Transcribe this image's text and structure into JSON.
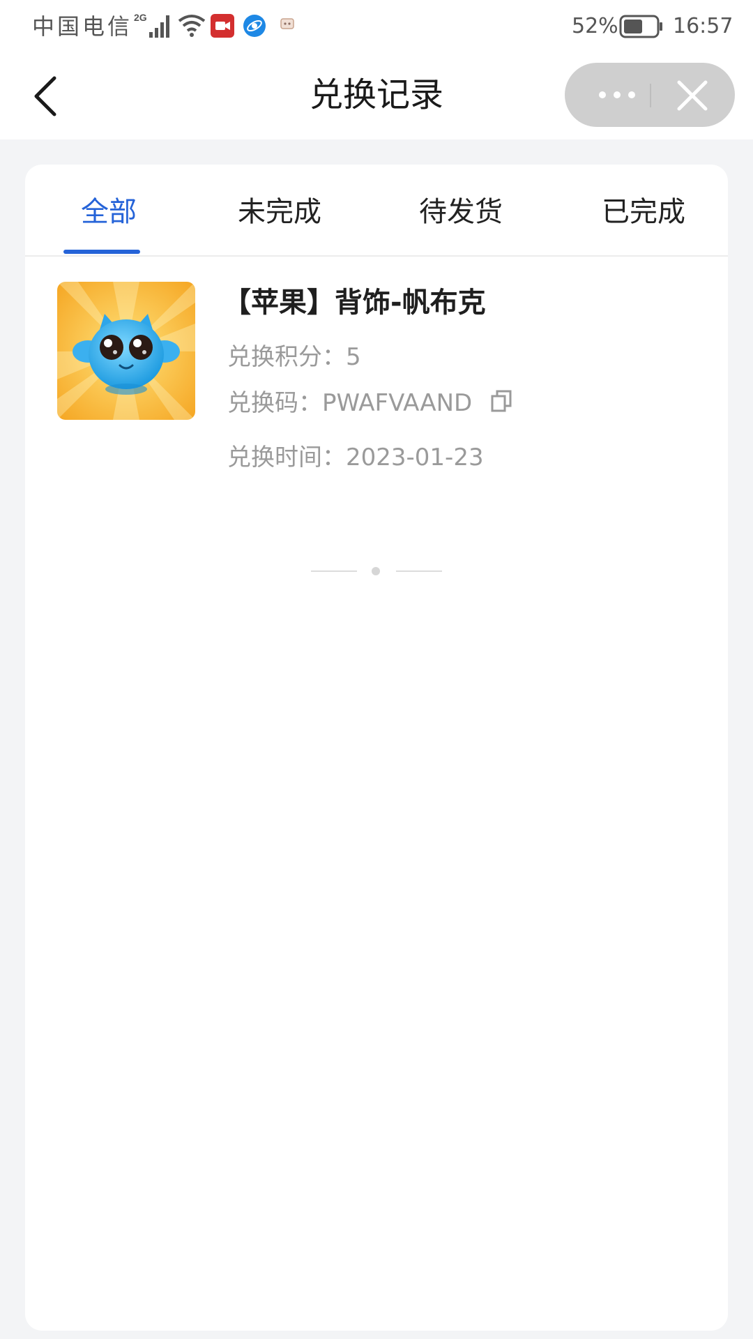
{
  "status_bar": {
    "carrier": "中国电信",
    "network": "2G",
    "battery": "52%",
    "time": "16:57"
  },
  "nav": {
    "title": "兑换记录"
  },
  "tabs": [
    {
      "label": "全部",
      "active": true
    },
    {
      "label": "未完成",
      "active": false
    },
    {
      "label": "待发货",
      "active": false
    },
    {
      "label": "已完成",
      "active": false
    }
  ],
  "items": [
    {
      "title": "【苹果】背饰-帆布克",
      "points_label": "兑换积分：",
      "points": "5",
      "code_label": "兑换码：",
      "code": "PWAFVAAND",
      "time_label": "兑换时间：",
      "time": "2023-01-23"
    }
  ],
  "colors": {
    "accent": "#2563d8",
    "background": "#f3f4f6",
    "muted_text": "#9a9a9a"
  }
}
